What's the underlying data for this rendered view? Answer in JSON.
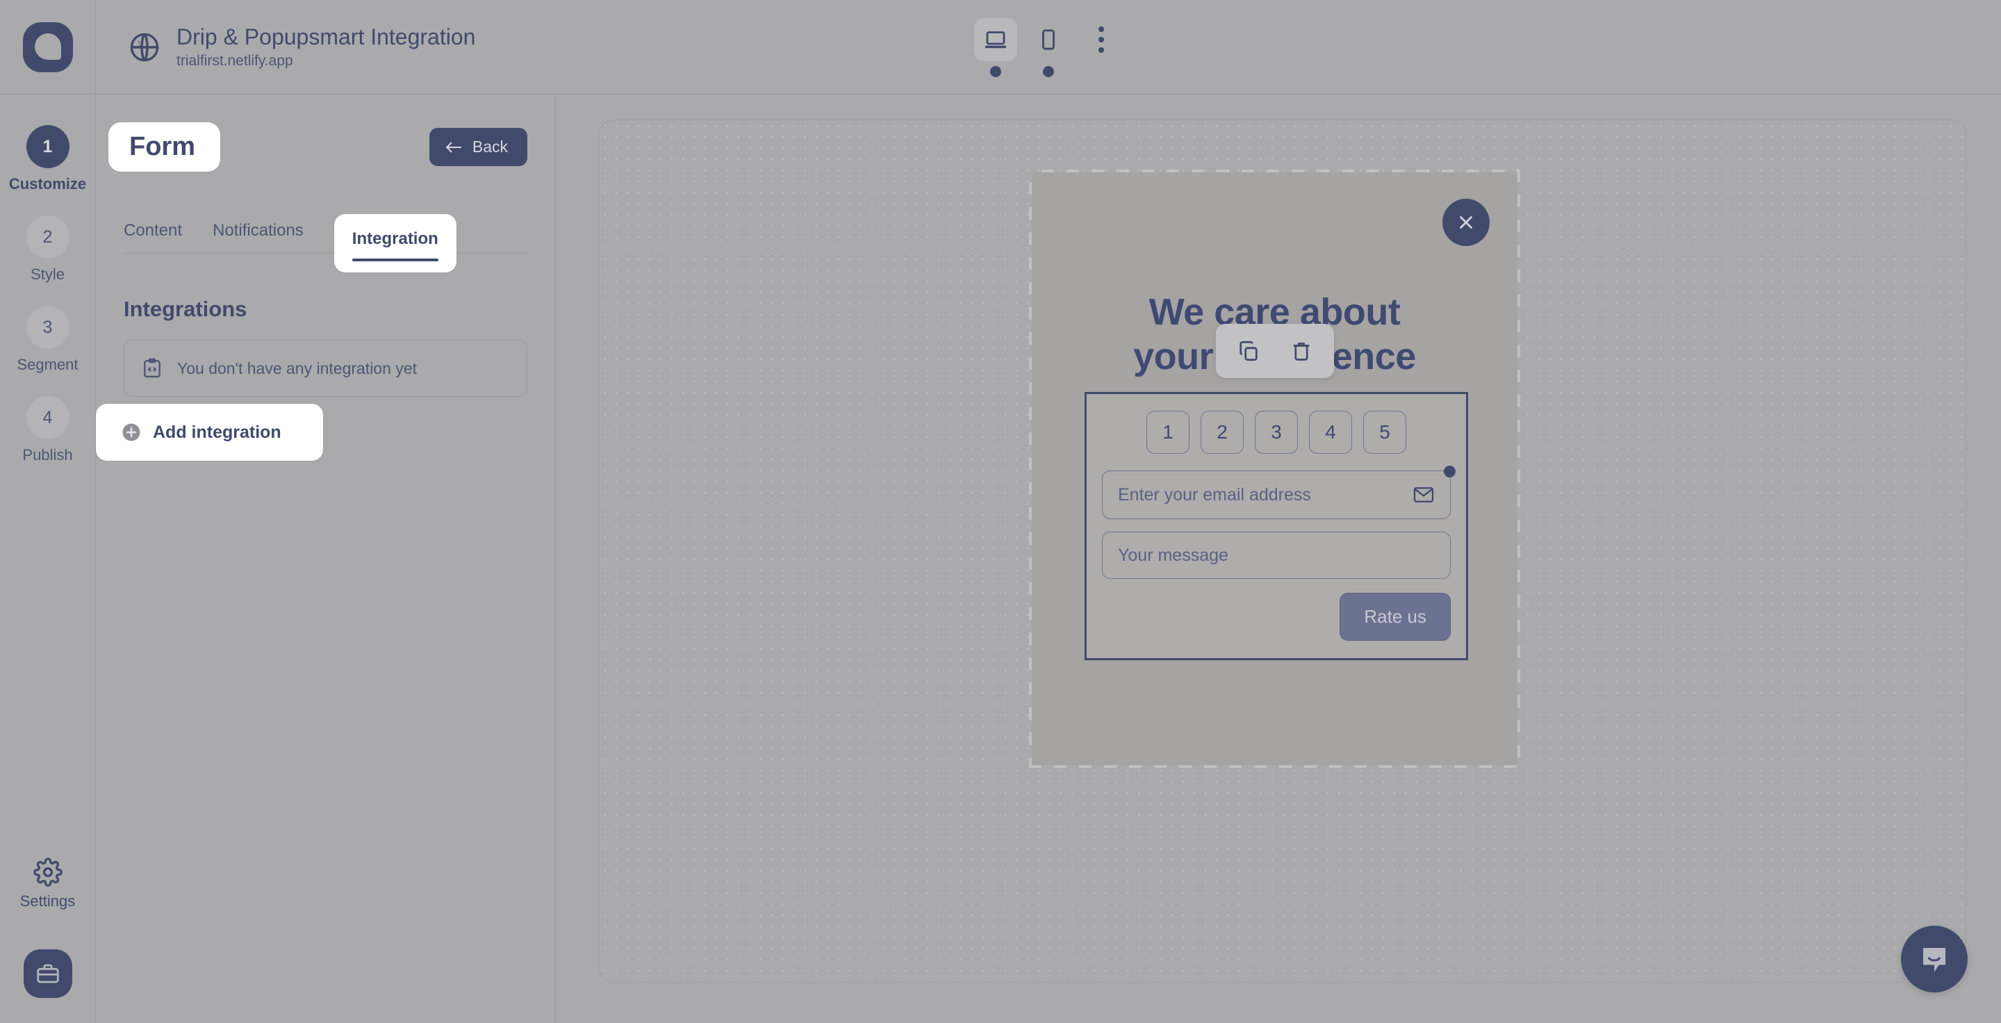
{
  "brand": {
    "logo_icon": "popupsmart-logo-icon",
    "accent_color": "#414a6b",
    "panel_bg": "#aaaaad"
  },
  "topbar": {
    "site_icon": "globe-icon",
    "title": "Drip & Popupsmart Integration",
    "url": "trialfirst.netlify.app",
    "devices": [
      {
        "name": "desktop",
        "icon": "desktop-icon",
        "active": true
      },
      {
        "name": "mobile",
        "icon": "mobile-icon",
        "active": false
      }
    ],
    "more_icon": "kebab-menu-icon"
  },
  "rail": {
    "steps": [
      {
        "number": "1",
        "label": "Customize",
        "active": true
      },
      {
        "number": "2",
        "label": "Style",
        "active": false
      },
      {
        "number": "3",
        "label": "Segment",
        "active": false
      },
      {
        "number": "4",
        "label": "Publish",
        "active": false
      }
    ],
    "settings_label": "Settings",
    "settings_icon": "gear-icon",
    "briefcase_icon": "briefcase-icon"
  },
  "panel": {
    "title": "Form",
    "back_label": "Back",
    "back_icon": "arrow-left-icon",
    "tabs": [
      {
        "label": "Content",
        "active": false
      },
      {
        "label": "Notifications",
        "active": false
      },
      {
        "label": "Integration",
        "active": true
      }
    ],
    "section_title": "Integrations",
    "empty_state": {
      "icon": "code-clipboard-icon",
      "text": "You don't have any integration yet"
    },
    "add_integration": {
      "icon": "plus-circle-icon",
      "label": "Add integration"
    }
  },
  "canvas": {
    "popup": {
      "close_icon": "close-icon",
      "heading_line1": "We care about",
      "heading_line2": "your experience",
      "element_toolbar": [
        {
          "name": "duplicate",
          "icon": "copy-icon"
        },
        {
          "name": "delete",
          "icon": "trash-icon"
        }
      ],
      "form": {
        "rating_options": [
          "1",
          "2",
          "3",
          "4",
          "5"
        ],
        "email_placeholder": "Enter your email address",
        "email_icon": "envelope-icon",
        "message_placeholder": "Your message",
        "submit_label": "Rate us",
        "selected": true
      }
    }
  },
  "chat": {
    "icon": "chat-bubble-icon"
  }
}
